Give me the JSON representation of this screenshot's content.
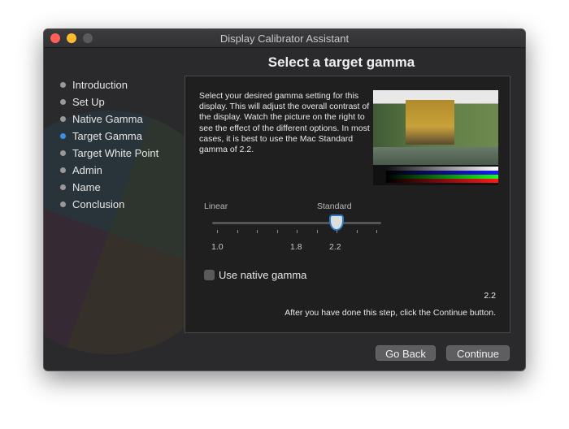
{
  "window": {
    "title": "Display Calibrator Assistant"
  },
  "heading": "Select a target gamma",
  "steps": [
    {
      "label": "Introduction",
      "active": false
    },
    {
      "label": "Set Up",
      "active": false
    },
    {
      "label": "Native Gamma",
      "active": false
    },
    {
      "label": "Target Gamma",
      "active": true
    },
    {
      "label": "Target White Point",
      "active": false
    },
    {
      "label": "Admin",
      "active": false
    },
    {
      "label": "Name",
      "active": false
    },
    {
      "label": "Conclusion",
      "active": false
    }
  ],
  "description": "Select your desired gamma setting for this display. This will adjust the overall contrast of the display. Watch the picture on the right to see the effect of the different options. In most cases, it is best to use the Mac Standard gamma of 2.2.",
  "slider": {
    "label_left": "Linear",
    "label_standard": "Standard",
    "ticks": [
      "1.0",
      "1.8",
      "2.2"
    ],
    "min": 1.0,
    "max": 2.6,
    "value": 2.2
  },
  "native_checkbox": {
    "label": "Use native gamma",
    "checked": false
  },
  "value_readout": "2.2",
  "instruction": "After you have done this step, click the Continue button.",
  "buttons": {
    "back": "Go Back",
    "continue": "Continue"
  },
  "colors": {
    "accent": "#2a78c8",
    "close": "#fe5f57",
    "minimize": "#febc2e",
    "zoom_disabled": "#5a5a5c"
  }
}
